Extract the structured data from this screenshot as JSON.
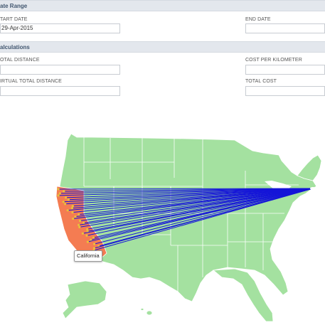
{
  "date_range": {
    "header": "ate Range",
    "start_date_label": "TART DATE",
    "start_date_value": "29-Apr-2015",
    "end_date_label": "END DATE",
    "end_date_value": ""
  },
  "calculations": {
    "header": "alculations",
    "total_distance_label": "OTAL DISTANCE",
    "total_distance_value": "",
    "virtual_total_distance_label": "IRTUAL TOTAL DISTANCE",
    "virtual_total_distance_value": "",
    "cost_per_km_label": "COST PER KILOMETER",
    "cost_per_km_value": "",
    "total_cost_label": "TOTAL COST",
    "total_cost_value": ""
  },
  "map": {
    "tooltip": "California",
    "colors": {
      "land": "#a4e1a0",
      "highlight": "#f47c52",
      "route": "#1515d8",
      "border": "#ffffff"
    },
    "highlighted_region": "California",
    "route_count": 30
  }
}
